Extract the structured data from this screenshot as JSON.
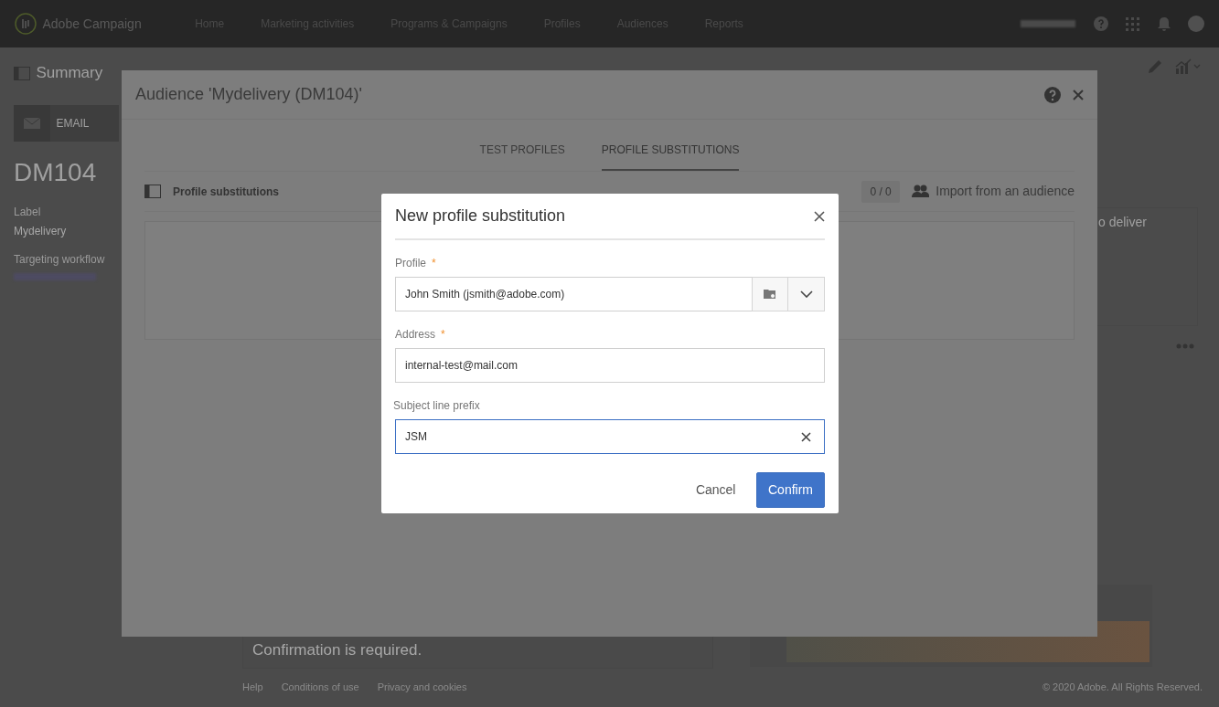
{
  "app_bar": {
    "brand": "Adobe Campaign",
    "nav": [
      {
        "label": "Home"
      },
      {
        "label": "Marketing activities"
      },
      {
        "label": "Programs & Campaigns"
      },
      {
        "label": "Profiles"
      },
      {
        "label": "Audiences"
      },
      {
        "label": "Reports"
      }
    ]
  },
  "page": {
    "title": "Summary",
    "channel": "EMAIL",
    "code": "DM104",
    "label_caption": "Label",
    "label_value": "Mydelivery",
    "workflow_caption": "Targeting workflow",
    "stat_label": "o deliver",
    "message": "Confirmation is required.",
    "footer_links": [
      "Help",
      "Conditions of use",
      "Privacy and cookies"
    ],
    "copyright": "© 2020 Adobe. All Rights Reserved."
  },
  "audience_dialog": {
    "title": "Audience 'Mydelivery (DM104)'",
    "tabs": [
      {
        "label": "TEST PROFILES",
        "selected": false
      },
      {
        "label": "PROFILE SUBSTITUTIONS",
        "selected": true
      }
    ],
    "section_title": "Profile substitutions",
    "counter": "0 / 0",
    "import_button": "Import from an audience"
  },
  "substitution_dialog": {
    "title": "New profile substitution",
    "required_mark": "*",
    "fields": [
      {
        "kind": "lookup",
        "label": "Profile",
        "required": true,
        "value": "John Smith (jsmith@adobe.com)",
        "focused": false
      },
      {
        "kind": "text",
        "label": "Address",
        "required": true,
        "value": "internal-test@mail.com",
        "focused": false
      },
      {
        "kind": "clearable",
        "label": "Subject line prefix",
        "required": false,
        "value": "JSM",
        "focused": true
      }
    ],
    "buttons": [
      {
        "label": "Cancel",
        "primary": false
      },
      {
        "label": "Confirm",
        "primary": true
      }
    ]
  }
}
